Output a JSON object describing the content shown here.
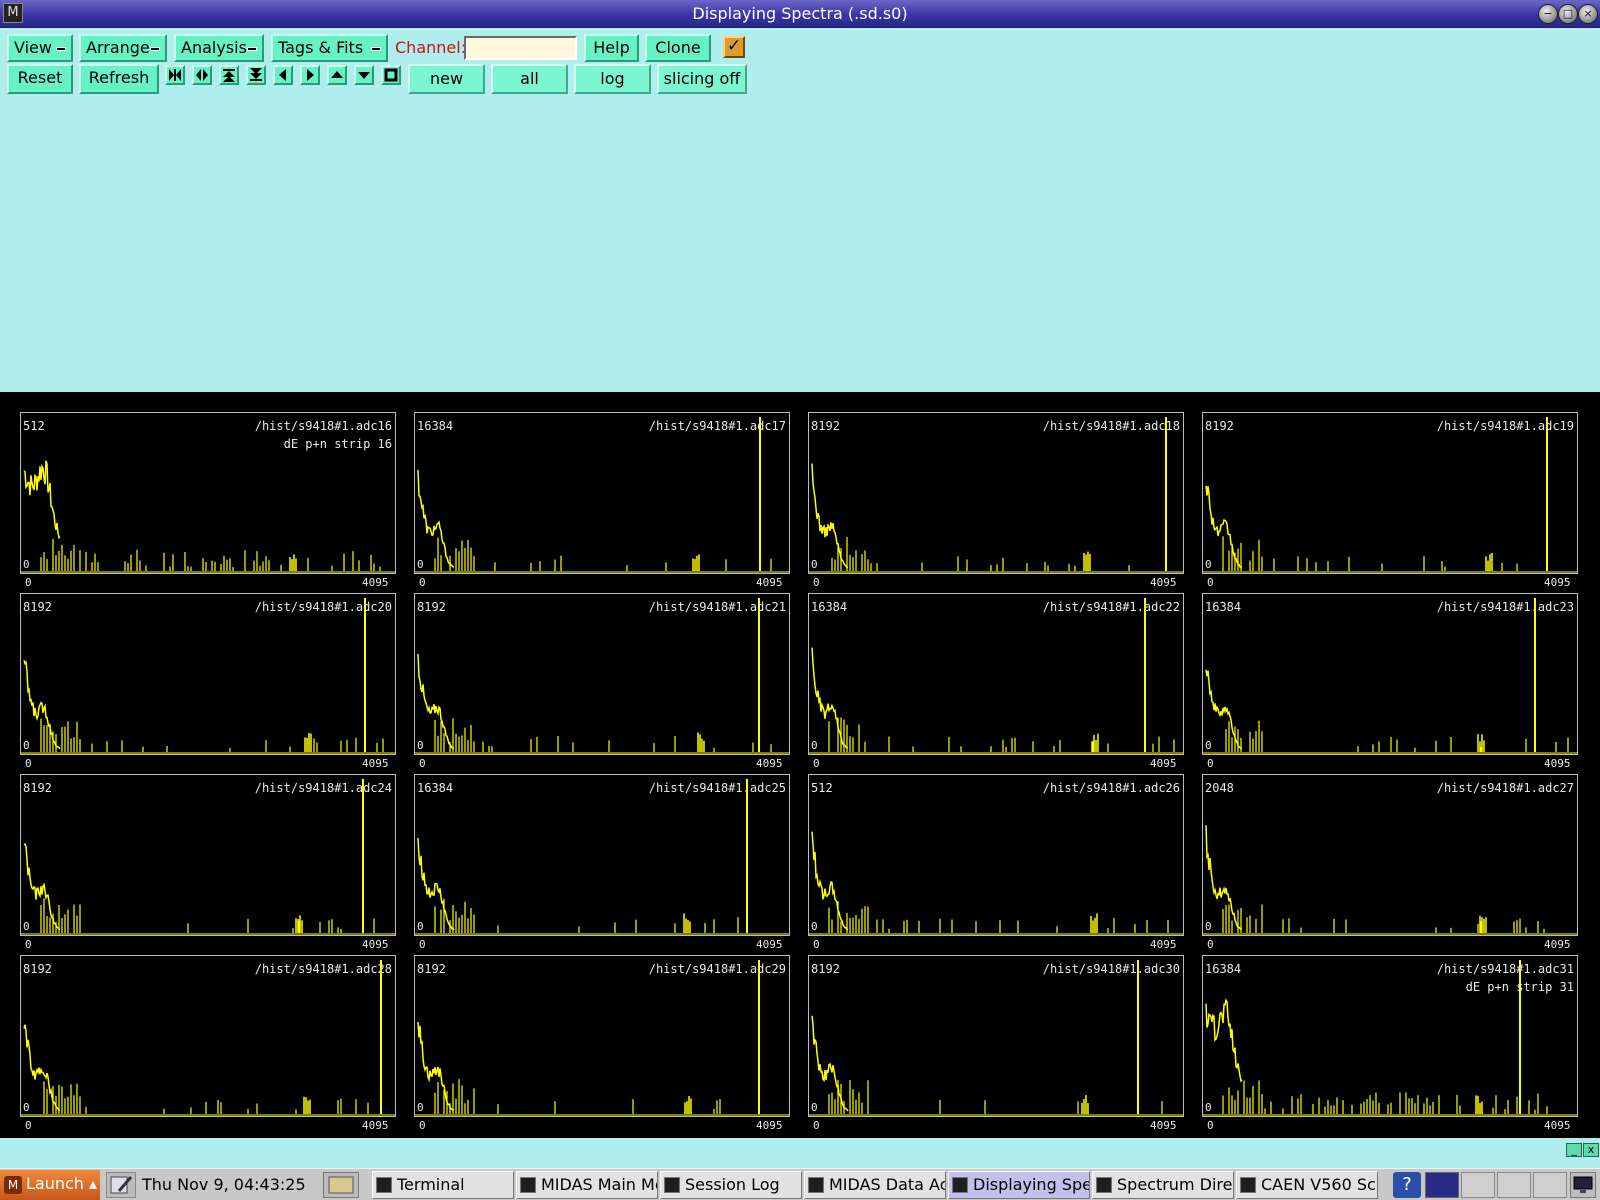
{
  "window": {
    "title": "Displaying Spectra (.sd.s0)"
  },
  "menus": [
    "View",
    "Arrange",
    "Analysis",
    "Tags & Fits"
  ],
  "channel": {
    "label": "Channel:",
    "value": ""
  },
  "buttons": {
    "help": "Help",
    "clone": "Clone",
    "reset": "Reset",
    "refresh": "Refresh",
    "new": "new",
    "all": "all",
    "log": "log",
    "slicing": "slicing off"
  },
  "checkbox_checked": true,
  "colors": {
    "spectrum": "#ffff00",
    "background": "#b0eded",
    "button": "#66f2c4",
    "plot_bg": "#000000"
  },
  "spectra": {
    "x_min": "0",
    "x_max": "4095",
    "panels": [
      {
        "name": "/hist/s9418#1.adc16",
        "y_max": "512",
        "subtitle": "dE p+n strip 16"
      },
      {
        "name": "/hist/s9418#1.adc17",
        "y_max": "16384"
      },
      {
        "name": "/hist/s9418#1.adc18",
        "y_max": "8192"
      },
      {
        "name": "/hist/s9418#1.adc19",
        "y_max": "8192"
      },
      {
        "name": "/hist/s9418#1.adc20",
        "y_max": "8192"
      },
      {
        "name": "/hist/s9418#1.adc21",
        "y_max": "8192"
      },
      {
        "name": "/hist/s9418#1.adc22",
        "y_max": "16384"
      },
      {
        "name": "/hist/s9418#1.adc23",
        "y_max": "16384"
      },
      {
        "name": "/hist/s9418#1.adc24",
        "y_max": "8192"
      },
      {
        "name": "/hist/s9418#1.adc25",
        "y_max": "16384"
      },
      {
        "name": "/hist/s9418#1.adc26",
        "y_max": "512"
      },
      {
        "name": "/hist/s9418#1.adc27",
        "y_max": "2048"
      },
      {
        "name": "/hist/s9418#1.adc28",
        "y_max": "8192"
      },
      {
        "name": "/hist/s9418#1.adc29",
        "y_max": "8192"
      },
      {
        "name": "/hist/s9418#1.adc30",
        "y_max": "8192"
      },
      {
        "name": "/hist/s9418#1.adc31",
        "y_max": "16384",
        "subtitle": "dE p+n strip 31"
      }
    ]
  },
  "taskbar": {
    "launch": "Launch",
    "clock": "Thu Nov  9, 04:43:25",
    "tasks": [
      {
        "label": "Terminal",
        "active": false
      },
      {
        "label": "MIDAS Main Me",
        "active": false
      },
      {
        "label": "Session Log",
        "active": false
      },
      {
        "label": "MIDAS Data Ac",
        "active": false
      },
      {
        "label": "Displaying Spe",
        "active": true
      },
      {
        "label": "Spectrum Direc",
        "active": false
      },
      {
        "label": "CAEN V560 Sc",
        "active": false
      }
    ]
  },
  "icons": [
    "app-icon",
    "minimize-icon",
    "maximize-icon",
    "close-icon",
    "first-icon",
    "expand-icon",
    "top-icon",
    "bottom-icon",
    "left-icon",
    "right-icon",
    "up-icon",
    "down-icon",
    "stop-icon",
    "help-icon"
  ]
}
